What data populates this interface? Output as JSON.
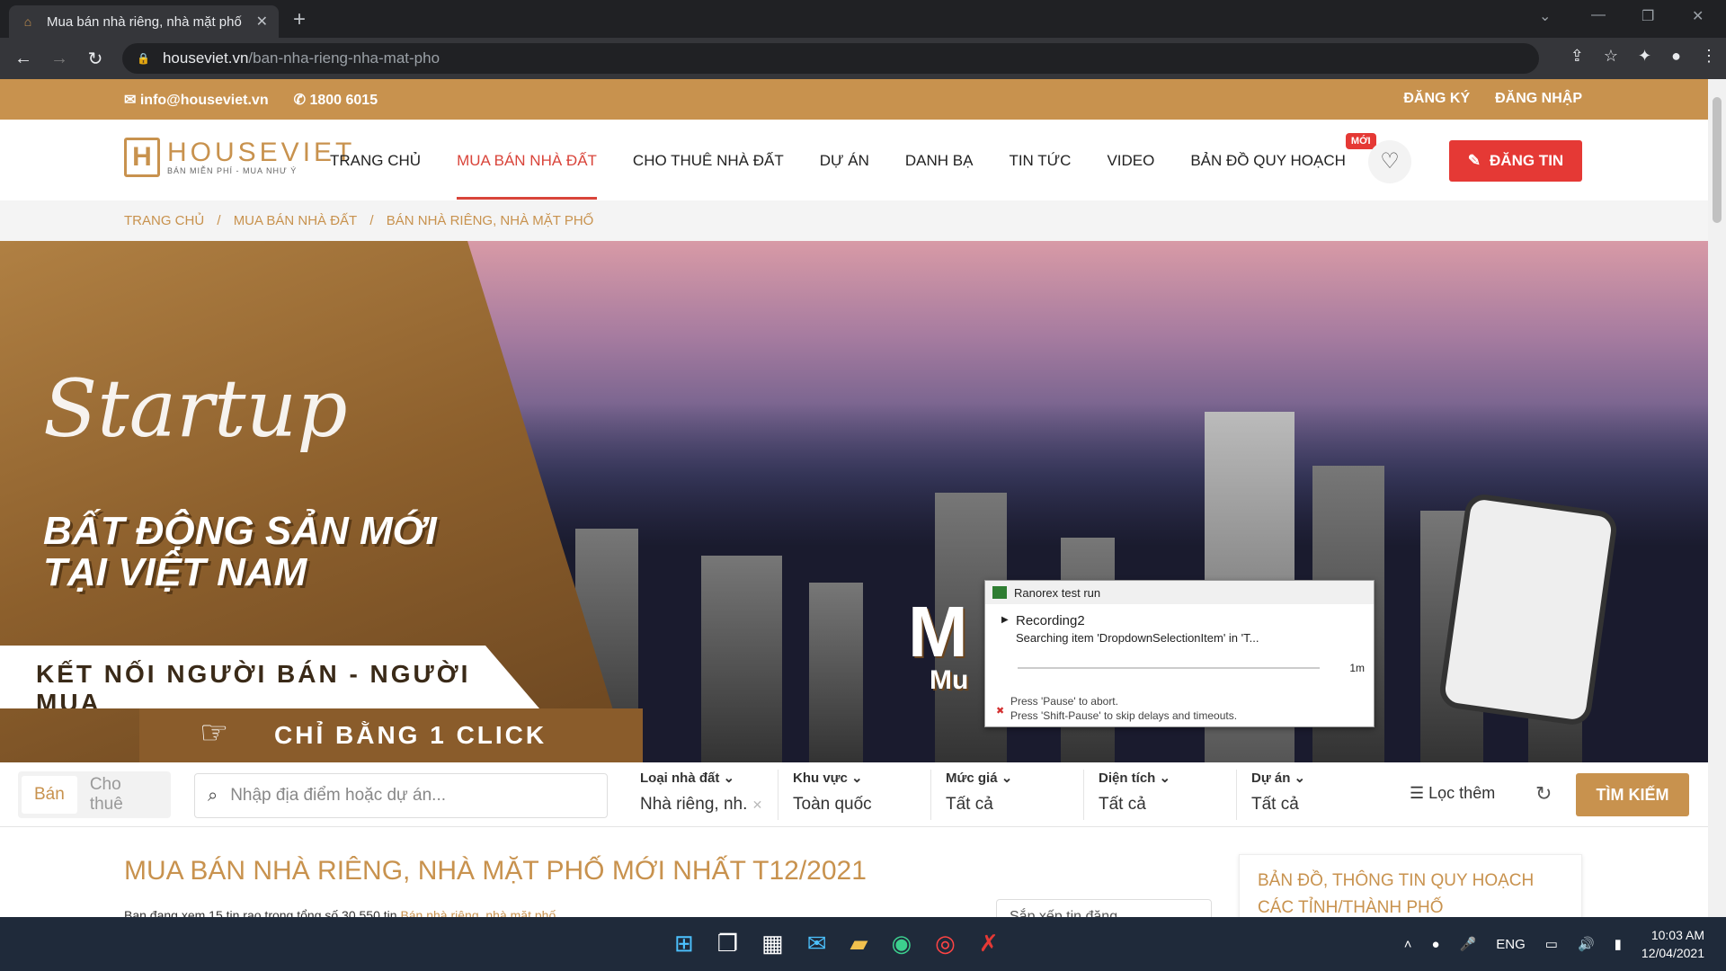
{
  "browser": {
    "tab_title": "Mua bán nhà riêng, nhà mặt phố",
    "url_host": "houseviet.vn",
    "url_path": "/ban-nha-rieng-nha-mat-pho"
  },
  "topbar": {
    "email": "info@houseviet.vn",
    "phone": "1800 6015",
    "register": "ĐĂNG KÝ",
    "login": "ĐĂNG NHẬP"
  },
  "logo": {
    "name": "HOUSEVIET",
    "slogan": "BÁN MIỄN PHÍ - MUA NHƯ Ý"
  },
  "nav": {
    "items": [
      "TRANG CHỦ",
      "MUA BÁN NHÀ ĐẤT",
      "CHO THUÊ NHÀ ĐẤT",
      "DỰ ÁN",
      "DANH BẠ",
      "TIN TỨC",
      "VIDEO",
      "BẢN ĐỒ QUY HOẠCH"
    ],
    "active": "MUA BÁN NHÀ ĐẤT",
    "new_badge": "MỚI",
    "post_button": "ĐĂNG TIN"
  },
  "breadcrumb": [
    "TRANG CHỦ",
    "/",
    "MUA BÁN NHÀ ĐẤT",
    "/",
    "BÁN NHÀ RIÊNG, NHÀ MẶT PHỐ"
  ],
  "hero": {
    "script": "Startup",
    "line1": "BẤT ĐỘNG SẢN MỚI",
    "line2": "TẠI VIỆT NAM",
    "band1": "KẾT NỐI NGƯỜI BÁN - NGƯỜI MUA",
    "band2": "CHỈ BẰNG 1 CLICK",
    "fragment_big": "M",
    "fragment_small": "Mu"
  },
  "ranorex": {
    "title": "Ranorex test run",
    "recording": "Recording2",
    "message": "Searching item 'DropdownSelectionItem' in 'T...",
    "time": "1m",
    "abort": "Press 'Pause' to abort.",
    "skip": "Press 'Shift-Pause' to skip delays and timeouts."
  },
  "search": {
    "mode_sell": "Bán",
    "mode_rent": "Cho thuê",
    "placeholder": "Nhập địa điểm hoặc dự án...",
    "filters": [
      {
        "label": "Loại nhà đất",
        "value": "Nhà riêng, nh."
      },
      {
        "label": "Khu vực",
        "value": "Toàn quốc"
      },
      {
        "label": "Mức giá",
        "value": "Tất cả"
      },
      {
        "label": "Diện tích",
        "value": "Tất cả"
      },
      {
        "label": "Dự án",
        "value": "Tất cả"
      }
    ],
    "more": "Lọc thêm",
    "find": "TÌM KIẾM"
  },
  "listing": {
    "title": "MUA BÁN NHÀ RIÊNG, NHÀ MẶT PHỐ MỚI NHẤT T12/2021",
    "sub_text": "Bạn đang xem 15 tin rao trong tổng số 30.550 tin",
    "sub_link": "Bán nhà riêng, nhà mặt phố",
    "sort": "Sắp xếp tin đăng"
  },
  "side": {
    "title": "BẢN ĐỒ, THÔNG TIN QUY HOẠCH CÁC TỈNH/THÀNH PHỐ"
  },
  "taskbar": {
    "lang": "ENG",
    "time": "10:03 AM",
    "date": "12/04/2021"
  }
}
